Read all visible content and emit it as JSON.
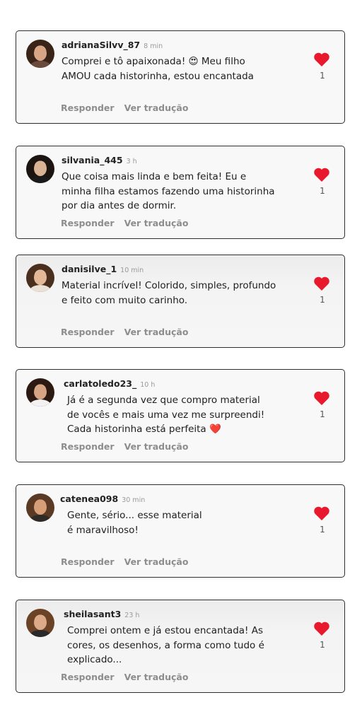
{
  "accent_color": "#e8192c",
  "comments": [
    {
      "username": "adrianaSilvv_87",
      "time": "8 min",
      "text_lines": [
        "Comprei e tô apaixonada! 😍 Meu filho",
        "AMOU cada historinha, estou encantada"
      ],
      "likes": "1",
      "reply_label": "Responder",
      "translate_label": "Ver tradução"
    },
    {
      "username": "silvania_445",
      "time": "3 h",
      "text_lines": [
        "Que coisa mais linda e bem feita! Eu e",
        "minha filha estamos fazendo uma historinha",
        "por dia antes de dormir."
      ],
      "likes": "1",
      "reply_label": "Responder",
      "translate_label": "Ver tradução"
    },
    {
      "username": "danisilve_1",
      "time": "10 min",
      "text_lines": [
        "Material incrível! Colorido, simples, profundo",
        "e feito com muito carinho."
      ],
      "likes": "1",
      "reply_label": "Responder",
      "translate_label": "Ver tradução"
    },
    {
      "username": "carlatoledo23_",
      "time": "10 h",
      "text_lines": [
        "Já é a segunda vez que compro material",
        "de vocês e mais uma vez me surpreendi!",
        "Cada historinha está perfeita ❤️"
      ],
      "likes": "1",
      "reply_label": "Responder",
      "translate_label": "Ver tradução"
    },
    {
      "username": "catenea098",
      "time": "30 min",
      "text_lines": [
        "Gente, sério... esse material",
        "é maravilhoso!"
      ],
      "likes": "1",
      "reply_label": "Responder",
      "translate_label": "Ver tradução"
    },
    {
      "username": "sheilasant3",
      "time": "23 h",
      "text_lines": [
        "Comprei ontem e já estou encantada! As",
        "cores, os desenhos, a forma como tudo é",
        "explicado..."
      ],
      "likes": "1",
      "reply_label": "Responder",
      "translate_label": "Ver tradução"
    }
  ]
}
